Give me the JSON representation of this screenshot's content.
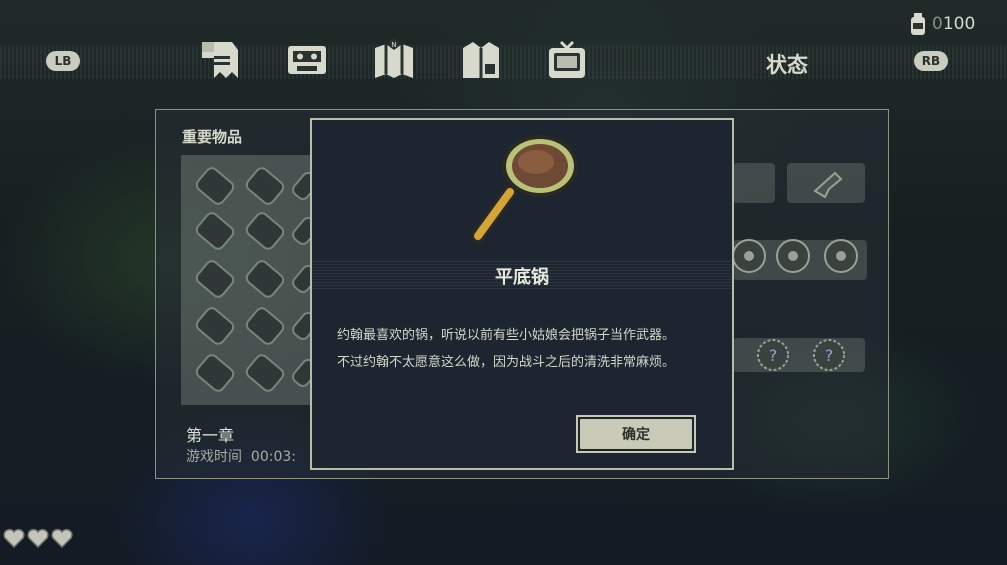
{
  "hud": {
    "lb_label": "LB",
    "rb_label": "RB",
    "section_title": "状态",
    "coin_count_dim": "0",
    "coin_count": "100",
    "tabs": [
      "scroll-icon",
      "cassette-icon",
      "map-icon",
      "jacket-icon",
      "tv-icon"
    ],
    "lives": [
      "heart-icon",
      "heart-icon",
      "heart-icon"
    ]
  },
  "panel": {
    "title": "重要物品",
    "chapter": "第一章",
    "playtime_label": "游戏时间",
    "playtime_value": "00:03:"
  },
  "modal": {
    "item_icon": "frying-pan-icon",
    "item_name": "平底锅",
    "description_line1": "约翰最喜欢的锅，听说以前有些小姑娘会把锅子当作武器。",
    "description_line2": "不过约翰不太愿意这么做，因为战斗之后的清洗非常麻烦。",
    "confirm_label": "确定"
  },
  "colors": {
    "accent": "#c9cbb8",
    "modal_bg": "#1c2530",
    "text": "#d5d7cc"
  }
}
